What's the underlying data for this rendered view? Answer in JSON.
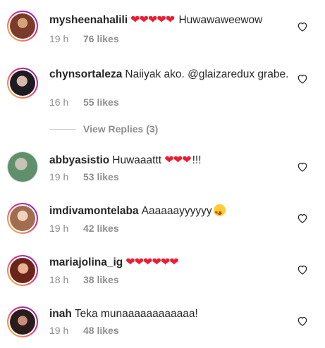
{
  "comments": [
    {
      "username": "mysheenahalili",
      "pre_text": "",
      "hearts": "❤❤❤❤❤",
      "text": " Huwawaweewow",
      "time": "19 h",
      "likes": "76 likes",
      "avatar_colors": [
        "#7a3b2a",
        "#d6a37d"
      ]
    },
    {
      "username": "chynsortaleza",
      "pre_text": "",
      "hearts": "",
      "text": "Naiiyak ako. @glaizaredux grabe.",
      "time": "16 h",
      "likes": "55 likes",
      "avatar_colors": [
        "#1d1a22",
        "#d7b9aa"
      ]
    },
    {
      "username": "abbyasistio",
      "pre_text": "Huwaaattt ",
      "hearts": "❤❤❤",
      "text": "!!!",
      "time": "19 h",
      "likes": "53 likes",
      "avatar_colors": [
        "#5f8f6b",
        "#c9c2b6"
      ]
    },
    {
      "username": "imdivamontelaba",
      "pre_text": "Aaaaaayyyyyy",
      "hearts": "",
      "text": "",
      "time": "19 h",
      "likes": "42 likes",
      "avatar_colors": [
        "#a06d4f",
        "#f0d2bd"
      ]
    },
    {
      "username": "mariajolina_ig",
      "pre_text": "",
      "hearts": "❤❤❤❤❤❤",
      "text": "",
      "time": "18 h",
      "likes": "38 likes",
      "avatar_colors": [
        "#6b2418",
        "#e8b296"
      ]
    },
    {
      "username": "inah",
      "pre_text": "",
      "hearts": "",
      "text": "Teka munaaaaaaaaaaaa!",
      "time": "19 h",
      "likes": "48 likes",
      "avatar_colors": [
        "#2a1c1a",
        "#c98e7a"
      ]
    }
  ],
  "view_replies": "View Replies (3)",
  "colors": {
    "meta_gray": "#8e8e8e",
    "heart_red": "#ed1c33",
    "story_ring_start": "#f9ce34",
    "story_ring_mid": "#ee2a7b",
    "story_ring_end": "#6228d7"
  },
  "icons": {
    "like": "heart-outline-icon",
    "hearts_emoji": "red-heart-emoji",
    "smile_emoji": "heart-eyes-emoji"
  }
}
